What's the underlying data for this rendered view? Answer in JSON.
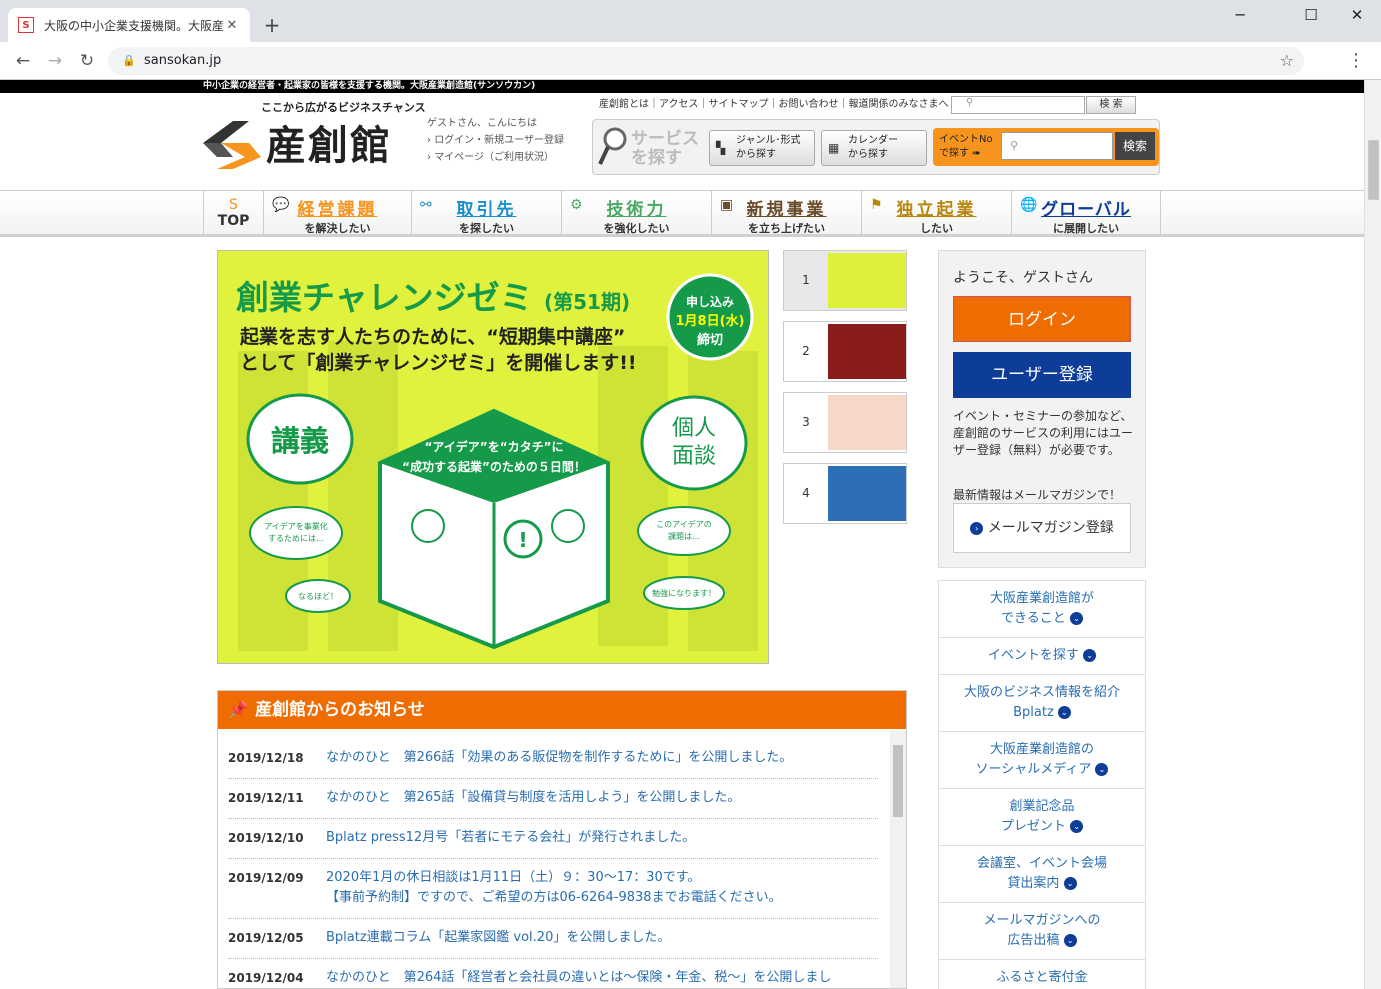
{
  "browser": {
    "tab_title": "大阪の中小企業支援機関。大阪産",
    "url": "sansokan.jp"
  },
  "site": {
    "top_strip": "中小企業の経営者・起業家の皆様を支援する機関。大阪産業創造館(サンソウカン)",
    "logo_tagline": "ここから広がるビジネスチャンス",
    "logo_name": "産創館",
    "guest_greeting": "ゲストさん、こんにちは",
    "guest_links": [
      "ログイン・新規ユーザー登録",
      "マイページ（ご利用状況）"
    ],
    "top_links": "産創館とは｜アクセス｜サイトマップ｜お問い合わせ｜報道関係のみなさまへ",
    "top_search_btn": "検 索",
    "service_label": [
      "サービス",
      "を探す"
    ],
    "service_buttons": [
      {
        "l1": "ジャンル･形式",
        "l2": "から探す"
      },
      {
        "l1": "カレンダー",
        "l2": "から探す"
      }
    ],
    "event_no": {
      "l1": "イベントNo",
      "l2": "で探す",
      "btn": "検索"
    }
  },
  "gnav": [
    {
      "t1": "TOP",
      "t2": "",
      "color": "#222"
    },
    {
      "t1": "経営課題",
      "t2": "を解決したい",
      "color": "#f7941d"
    },
    {
      "t1": "取引先",
      "t2": "を探したい",
      "color": "#1a8fd0"
    },
    {
      "t1": "技術力",
      "t2": "を強化したい",
      "color": "#4aa864"
    },
    {
      "t1": "新規事業",
      "t2": "を立ち上げたい",
      "color": "#6b4b2a"
    },
    {
      "t1": "独立起業",
      "t2": "したい",
      "color": "#b8860b"
    },
    {
      "t1": "グローバル",
      "t2": "に展開したい",
      "color": "#0d3c99"
    }
  ],
  "hero": {
    "title": "創業チャレンジゼミ",
    "period": "(第51期)",
    "badge": [
      "申し込み",
      "1月8日(水)",
      "締切"
    ],
    "line1": "起業を志す人たちのために、“短期集中講座”",
    "line2": "として「創業チャレンジゼミ」を開催します!!",
    "left_bubble": "講義",
    "right_bubble": [
      "個人",
      "面談"
    ],
    "box_top1": "“アイデア”を“カタチ”に",
    "box_top2": "“成功する起業”のための５日間！",
    "small1": [
      "アイデアを事業化",
      "するためには…"
    ],
    "small2": [
      "このアイデアの",
      "課題は…"
    ],
    "small3": "なるほど！",
    "small4": "勉強になります！"
  },
  "thumbs": [
    {
      "num": "1",
      "color": "#dff03a"
    },
    {
      "num": "2",
      "color": "#8b1a1a"
    },
    {
      "num": "3",
      "color": "#f6d7c8"
    },
    {
      "num": "4",
      "color": "#2c6fb5"
    }
  ],
  "news": {
    "heading": "産創館からのお知らせ",
    "rows": [
      {
        "date": "2019/12/18",
        "text": "なかのひと　第266話「効果のある販促物を制作するために」を公開しました。"
      },
      {
        "date": "2019/12/11",
        "text": "なかのひと　第265話「設備貸与制度を活用しよう」を公開しました。"
      },
      {
        "date": "2019/12/10",
        "text": "Bplatz press12月号「若者にモテる会社」が発行されました。"
      },
      {
        "date": "2019/12/09",
        "text": "2020年1月の休日相談は1月11日（土）９：30～17：30です。\n【事前予約制】ですので、ご希望の方は06-6264-9838までお電話ください。"
      },
      {
        "date": "2019/12/05",
        "text": "Bplatz連載コラム「起業家図鑑 vol.20」を公開しました。"
      },
      {
        "date": "2019/12/04",
        "text": "なかのひと　第264話「経営者と会社員の違いとは～保険・年金、税～」を公開しまし"
      }
    ]
  },
  "sidebar": {
    "welcome": "ようこそ、ゲストさん",
    "login": "ログイン",
    "register": "ユーザー登録",
    "desc": "イベント・セミナーの参加など、産創館のサービスの利用にはユーザー登録（無料）が必要です。",
    "mail_note": "最新情報はメールマガジンで！",
    "mail_btn": "メールマガジン登録",
    "menu": [
      [
        "大阪産業創造館が",
        "できること"
      ],
      [
        "イベントを探す"
      ],
      [
        "大阪のビジネス情報を紹介",
        "Bplatz"
      ],
      [
        "大阪産業創造館の",
        "ソーシャルメディア"
      ],
      [
        "創業記念品",
        "プレゼント"
      ],
      [
        "会議室、イベント会場",
        "貸出案内"
      ],
      [
        "メールマガジンへの",
        "広告出稿"
      ],
      [
        "ふるさと寄付金"
      ]
    ]
  }
}
